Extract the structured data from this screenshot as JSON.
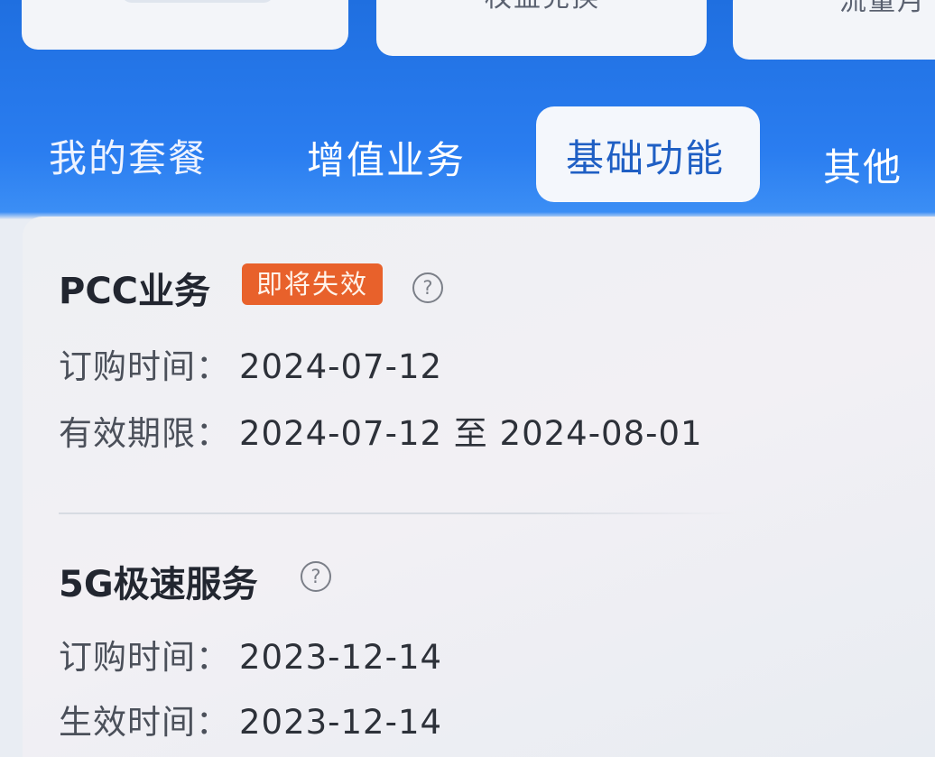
{
  "top_cards": [
    {
      "text": ""
    },
    {
      "text": "权益兑换"
    },
    {
      "text": "流量月卡"
    }
  ],
  "tabs": [
    {
      "label": "我的套餐",
      "active": false
    },
    {
      "label": "增值业务",
      "active": false
    },
    {
      "label": "基础功能",
      "active": true
    },
    {
      "label": "其他",
      "active": false
    }
  ],
  "items": [
    {
      "title": "PCC业务",
      "badge": "即将失效",
      "help_icon": "question-circle-icon",
      "rows": [
        {
          "key": "订购时间：",
          "value": "2024-07-12"
        },
        {
          "key": "有效期限：",
          "value": "2024-07-12 至 2024-08-01"
        }
      ]
    },
    {
      "title": "5G极速服务",
      "help_icon": "question-circle-icon",
      "rows": [
        {
          "key": "订购时间：",
          "value": "2023-12-14"
        },
        {
          "key": "生效时间：",
          "value": "2023-12-14"
        }
      ]
    }
  ],
  "colors": {
    "brand_blue": "#2a7df0",
    "active_tab_text": "#1f5fc4",
    "badge_orange": "#e8612b"
  }
}
